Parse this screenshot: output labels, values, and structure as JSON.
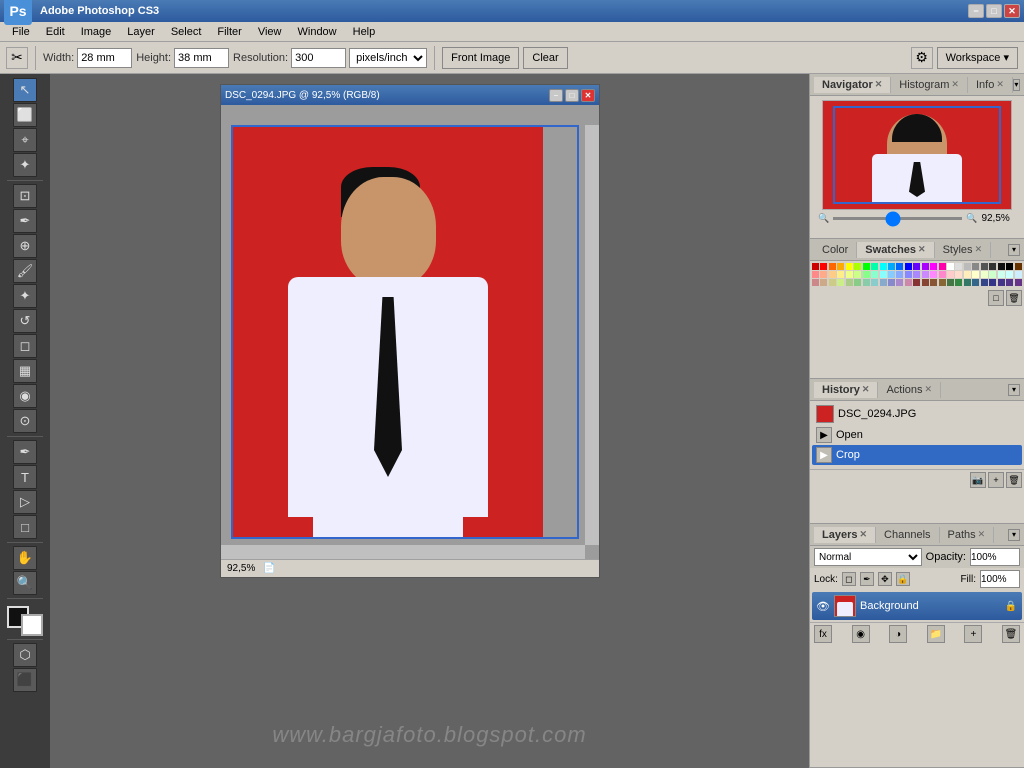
{
  "app": {
    "title": "Adobe Photoshop CS3",
    "ps_label": "Ps"
  },
  "titlebar": {
    "title": "Adobe Photoshop CS3",
    "min": "−",
    "max": "□",
    "close": "✕"
  },
  "menubar": {
    "items": [
      "File",
      "Edit",
      "Image",
      "Layer",
      "Select",
      "Filter",
      "View",
      "Window",
      "Help"
    ]
  },
  "toolbar": {
    "width_label": "Width:",
    "width_value": "28 mm",
    "height_label": "Height:",
    "height_value": "38 mm",
    "resolution_label": "Resolution:",
    "resolution_value": "300",
    "resolution_unit": "pixels/inch",
    "front_image": "Front Image",
    "clear": "Clear",
    "workspace": "Workspace ▾"
  },
  "document": {
    "title": "DSC_0294.JPG @ 92,5% (RGB/8)",
    "zoom": "92,5%",
    "min": "−",
    "max": "□",
    "close": "✕"
  },
  "navigator": {
    "tab": "Navigator",
    "histogram_tab": "Histogram",
    "info_tab": "Info",
    "zoom": "92,5%"
  },
  "color_panel": {
    "color_tab": "Color",
    "swatches_tab": "Swatches",
    "styles_tab": "Styles"
  },
  "history_panel": {
    "history_tab": "History",
    "actions_tab": "Actions",
    "items": [
      {
        "label": "DSC_0294.JPG",
        "type": "file"
      },
      {
        "label": "Open",
        "type": "action"
      },
      {
        "label": "Crop",
        "type": "action",
        "active": true
      }
    ]
  },
  "layers_panel": {
    "layers_tab": "Layers",
    "channels_tab": "Channels",
    "paths_tab": "Paths",
    "blend_mode": "Normal",
    "opacity_label": "Opacity:",
    "opacity_value": "100%",
    "fill_label": "Fill:",
    "fill_value": "100%",
    "lock_label": "Lock:",
    "layer_name": "Background"
  },
  "watermark": "www.bargjafoto.blogspot.com",
  "swatches_colors": [
    "#cc0000",
    "#ff0000",
    "#ff6600",
    "#ffaa00",
    "#ffff00",
    "#aaff00",
    "#00ff00",
    "#00ffaa",
    "#00ffff",
    "#00aaff",
    "#0066ff",
    "#0000ff",
    "#6600ff",
    "#aa00ff",
    "#ff00ff",
    "#ff00aa",
    "#ffffff",
    "#dddddd",
    "#bbbbbb",
    "#888888",
    "#555555",
    "#333333",
    "#111111",
    "#000000",
    "#663300",
    "#ff8888",
    "#ffaa88",
    "#ffcc88",
    "#ffee88",
    "#eeff88",
    "#ccff88",
    "#88ff88",
    "#88ffcc",
    "#88ffff",
    "#88ccff",
    "#88aaff",
    "#8888ff",
    "#aa88ff",
    "#cc88ff",
    "#ff88ff",
    "#ff88cc",
    "#ffcccc",
    "#ffddcc",
    "#ffeebb",
    "#ffffcc",
    "#eeffcc",
    "#ccffcc",
    "#ccffee",
    "#ccffff",
    "#cceeff",
    "#cc8888",
    "#ccaa88",
    "#cccc88",
    "#ccee88",
    "#aacc88",
    "#88cc88",
    "#88ccaa",
    "#88cccc",
    "#88aacc",
    "#8888cc",
    "#aa88cc",
    "#cc88aa",
    "#883333",
    "#884433",
    "#885533",
    "#886633",
    "#447744",
    "#338844",
    "#337766",
    "#336688",
    "#334488",
    "#333388",
    "#443388",
    "#553388",
    "#663388"
  ]
}
